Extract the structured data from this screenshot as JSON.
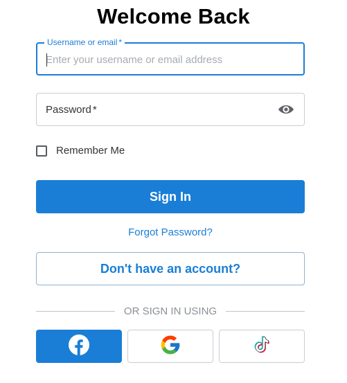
{
  "title": "Welcome Back",
  "username": {
    "label": "Username or email",
    "required_mark": "*",
    "placeholder": "Enter your username or email address",
    "value": ""
  },
  "password": {
    "label": "Password",
    "required_mark": "*",
    "toggle_icon": "eye-icon"
  },
  "remember": {
    "label": "Remember Me",
    "checked": false
  },
  "sign_in_label": "Sign In",
  "forgot_label": "Forgot Password?",
  "register_label": "Don't have an account?",
  "divider_label": "OR SIGN IN USING",
  "social": [
    {
      "name": "Facebook",
      "icon": "facebook-icon"
    },
    {
      "name": "Google",
      "icon": "google-icon"
    },
    {
      "name": "TikTok",
      "icon": "tiktok-icon"
    }
  ],
  "colors": {
    "accent": "#1a7ed6",
    "title": "#000000",
    "text": "#333333",
    "muted": "#8b9096",
    "border": "#c9cdd2"
  }
}
